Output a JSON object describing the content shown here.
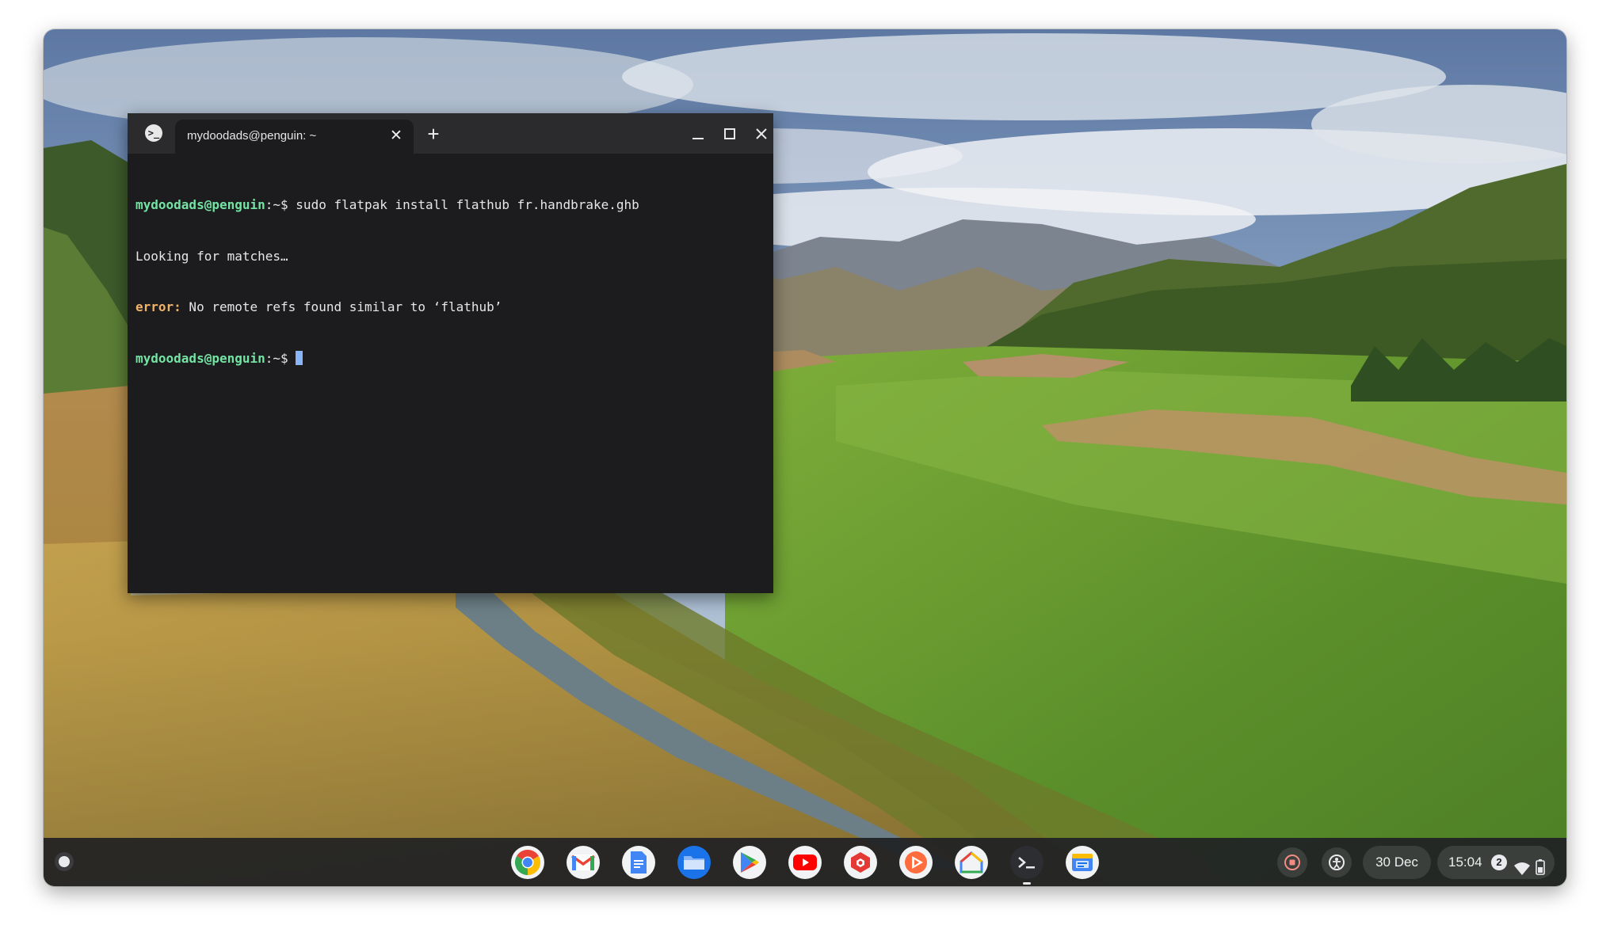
{
  "terminal": {
    "tab_title": "mydoodads@penguin: ~",
    "tab_close": "✕",
    "new_tab": "+",
    "app_icon": ">_",
    "lines": [
      {
        "prompt": "mydoodads@penguin",
        "sep": ":~$ ",
        "text": "sudo flatpak install flathub fr.handbrake.ghb"
      },
      {
        "text": "Looking for matches…"
      },
      {
        "label": "error:",
        "text": " No remote refs found similar to ‘flathub’"
      },
      {
        "prompt": "mydoodads@penguin",
        "sep": ":~$ ",
        "text": ""
      }
    ],
    "controls": [
      "minimize-icon",
      "maximize-icon",
      "close-icon"
    ]
  },
  "shelf": {
    "apps": [
      {
        "name": "chrome",
        "icon": "chrome-icon"
      },
      {
        "name": "gmail",
        "icon": "gmail-icon"
      },
      {
        "name": "docs",
        "icon": "docs-icon"
      },
      {
        "name": "files",
        "icon": "files-icon"
      },
      {
        "name": "play-store",
        "icon": "play-store-icon"
      },
      {
        "name": "youtube",
        "icon": "youtube-icon"
      },
      {
        "name": "app-red",
        "icon": "red-hexagon-icon"
      },
      {
        "name": "app-orange",
        "icon": "orange-play-icon"
      },
      {
        "name": "google-home",
        "icon": "google-home-icon"
      },
      {
        "name": "terminal",
        "icon": "terminal-icon",
        "running": true
      },
      {
        "name": "app-blue",
        "icon": "calendar-card-icon"
      }
    ],
    "tray": {
      "date": "30 Dec",
      "time": "15:04",
      "notification_count": "2",
      "icons": [
        "screen-record-icon",
        "accessibility-icon",
        "wifi-icon",
        "battery-icon"
      ]
    }
  },
  "colors": {
    "terminal_bg": "#1c1c1e",
    "terminal_titlebar": "#2b2b2d",
    "prompt": "#74e3a4",
    "error": "#f1b26a",
    "cursor": "#8ab4f8",
    "shelf": "#202124"
  }
}
